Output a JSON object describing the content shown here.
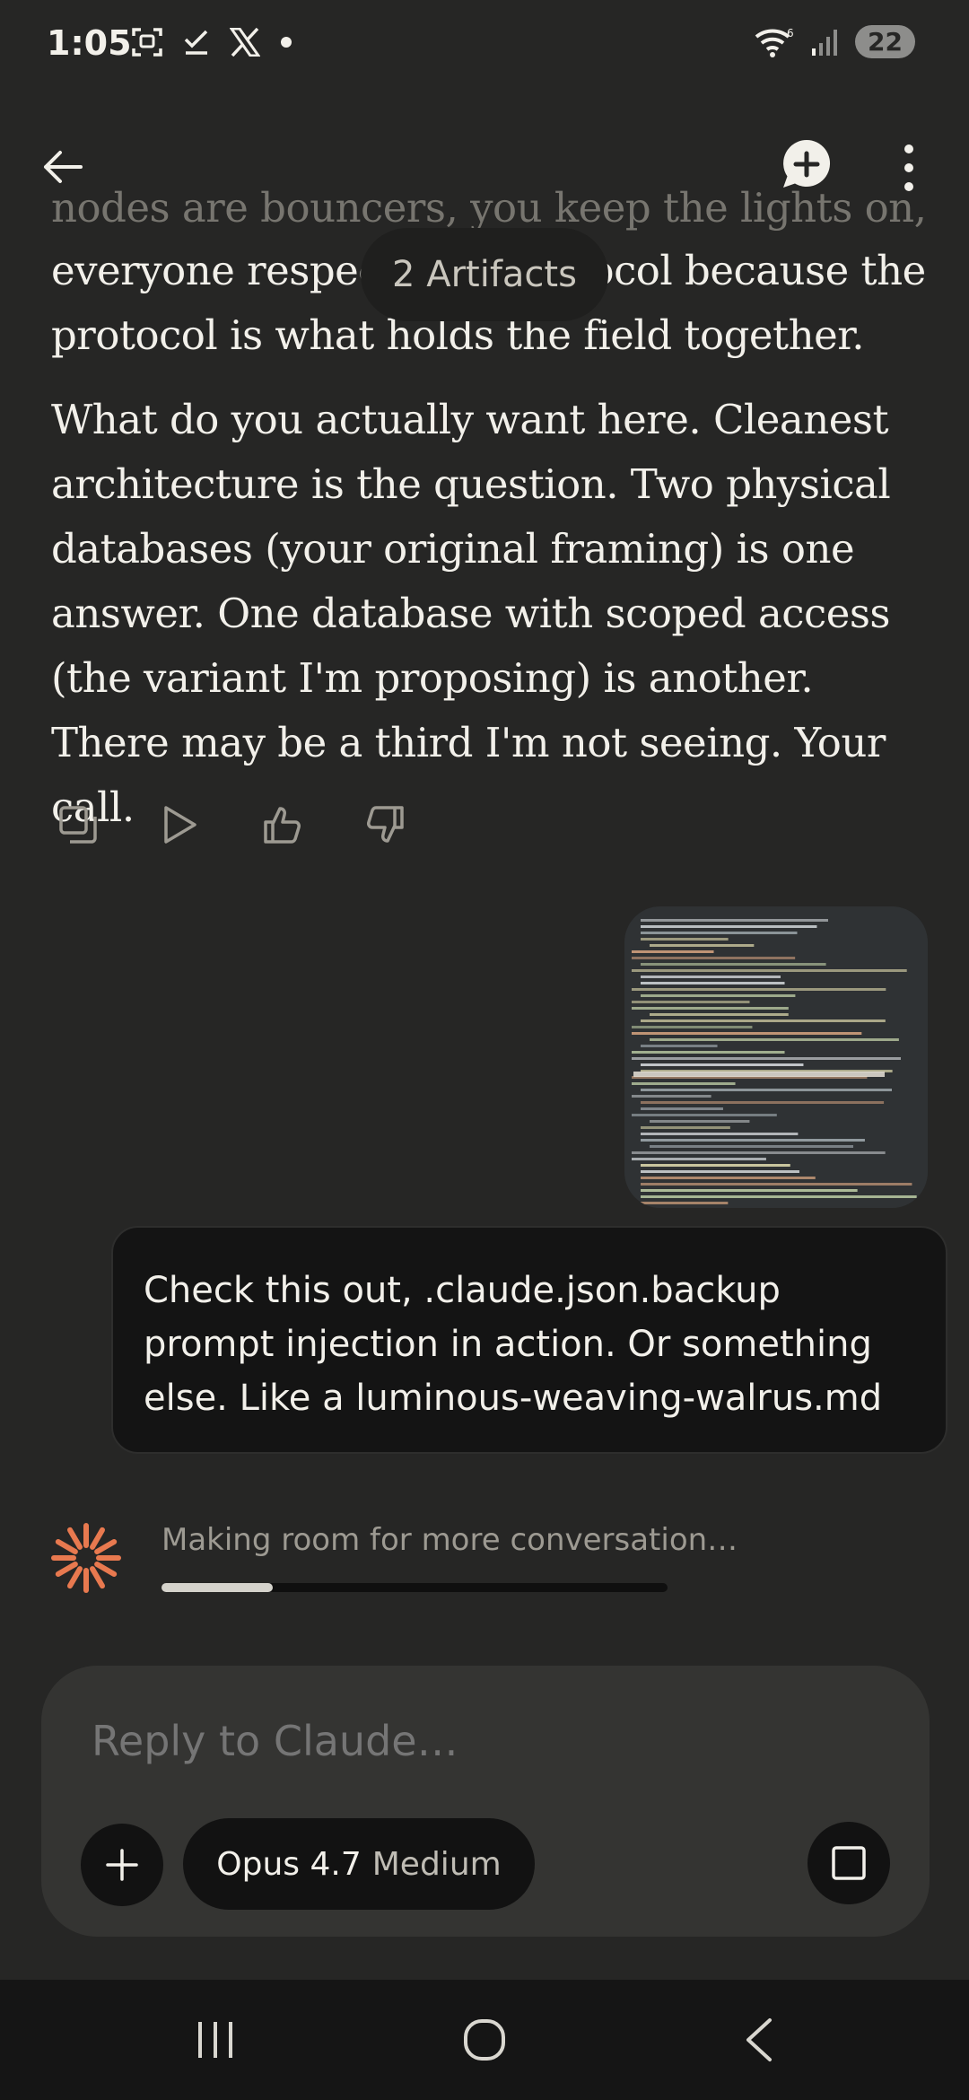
{
  "status_bar": {
    "time": "1:05",
    "wifi_label": "6",
    "battery": "22",
    "icons": [
      "screenshot-icon",
      "check-download-icon",
      "x-logo-icon",
      "dot-icon",
      "wifi-icon",
      "signal-icon",
      "battery-icon"
    ]
  },
  "top_nav": {
    "icons": [
      "back-arrow-icon",
      "new-chat-icon",
      "more-vertical-icon"
    ]
  },
  "artifacts": {
    "label": "2 Artifacts"
  },
  "message": {
    "faded_line": "nodes are bouncers, you keep the lights on,",
    "paragraph_1": "everyone respects the protocol because the protocol is what holds the field together.",
    "paragraph_2": "What do you actually want here. Cleanest architecture is the question. Two physical databases (your original framing) is one answer. One database with scoped access (the variant I'm proposing) is another. There may be a third I'm not seeing. Your call.",
    "action_icons": [
      "copy-icon",
      "play-icon",
      "thumbs-up-icon",
      "thumbs-down-icon"
    ]
  },
  "user_message": {
    "text": "Check this out, .claude.json.backup prompt injection in action. Or something else. Like a luminous-weaving-walrus.md"
  },
  "compaction": {
    "status": "Making room for more conversation…",
    "progress": 0.22
  },
  "composer": {
    "placeholder": "Reply to Claude…",
    "model": "Opus 4.7",
    "effort": "Medium",
    "icons": [
      "plus-icon",
      "stop-icon"
    ]
  },
  "system_nav": {
    "icons": [
      "recents-icon",
      "home-icon",
      "back-icon"
    ]
  },
  "colors": {
    "background": "#262625",
    "bubble": "#141414",
    "composer": "#343432",
    "accent_spinner": "#e8794f"
  }
}
